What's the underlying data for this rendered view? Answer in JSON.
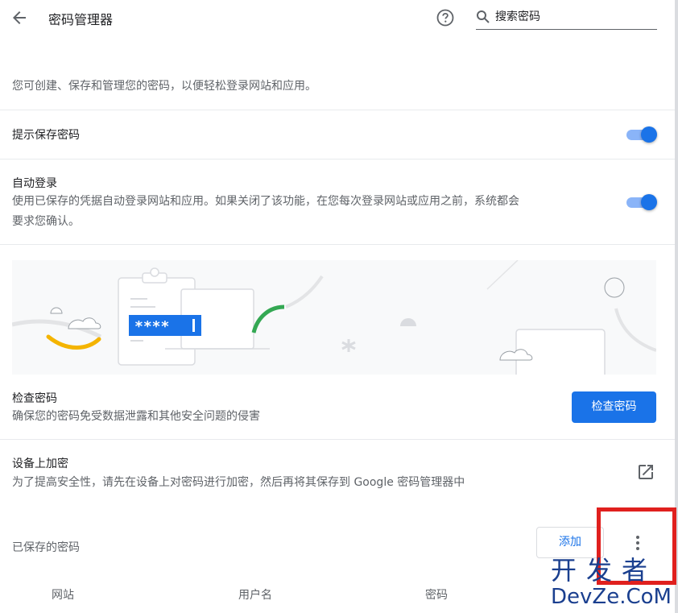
{
  "header": {
    "title": "密码管理器",
    "search_placeholder": "搜索密码"
  },
  "intro_text": "您可创建、保存和管理您的密码，以便轻松登录网站和应用。",
  "offer_to_save": {
    "label": "提示保存密码",
    "enabled": true
  },
  "auto_sign_in": {
    "label": "自动登录",
    "description_line1": "使用已保存的凭据自动登录网站和应用。如果关闭了该功能，在您每次登录网站或应用之前，系统都会",
    "description_line2": "要求您确认。",
    "enabled": true
  },
  "banner": {
    "masked_password": "****"
  },
  "check_passwords": {
    "title": "检查密码",
    "description": "确保您的密码免受数据泄露和其他安全问题的侵害",
    "button_label": "检查密码"
  },
  "on_device_encryption": {
    "title": "设备上加密",
    "description": "为了提高安全性，请先在设备上对密码进行加密，然后再将其保存到 Google 密码管理器中"
  },
  "saved_passwords": {
    "title": "已保存的密码",
    "add_button_label": "添加",
    "columns": [
      "网站",
      "用户名",
      "密码"
    ]
  },
  "watermark": {
    "cn": "开发者",
    "en": "DevZe.CoM"
  },
  "colors": {
    "accent": "#1a73e8",
    "toggle_track": "#8ab4f8",
    "highlight_box": "#e0201e",
    "watermark": "#1a3f8f"
  }
}
